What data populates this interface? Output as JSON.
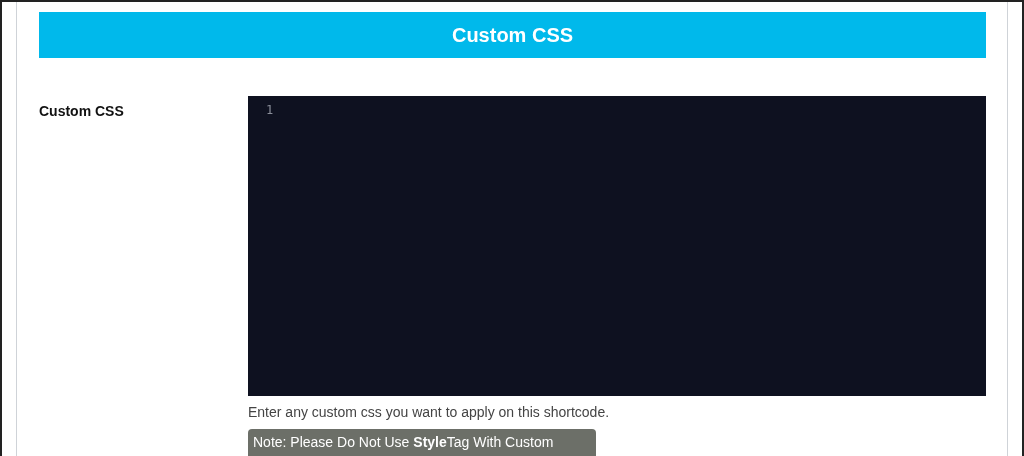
{
  "header": {
    "title": "Custom CSS"
  },
  "field": {
    "label": "Custom CSS",
    "editor": {
      "line_numbers": [
        "1"
      ]
    },
    "help": "Enter any custom css you want to apply on this shortcode.",
    "note": "Note: Please Do Not Use **Style**Tag With Custom"
  }
}
